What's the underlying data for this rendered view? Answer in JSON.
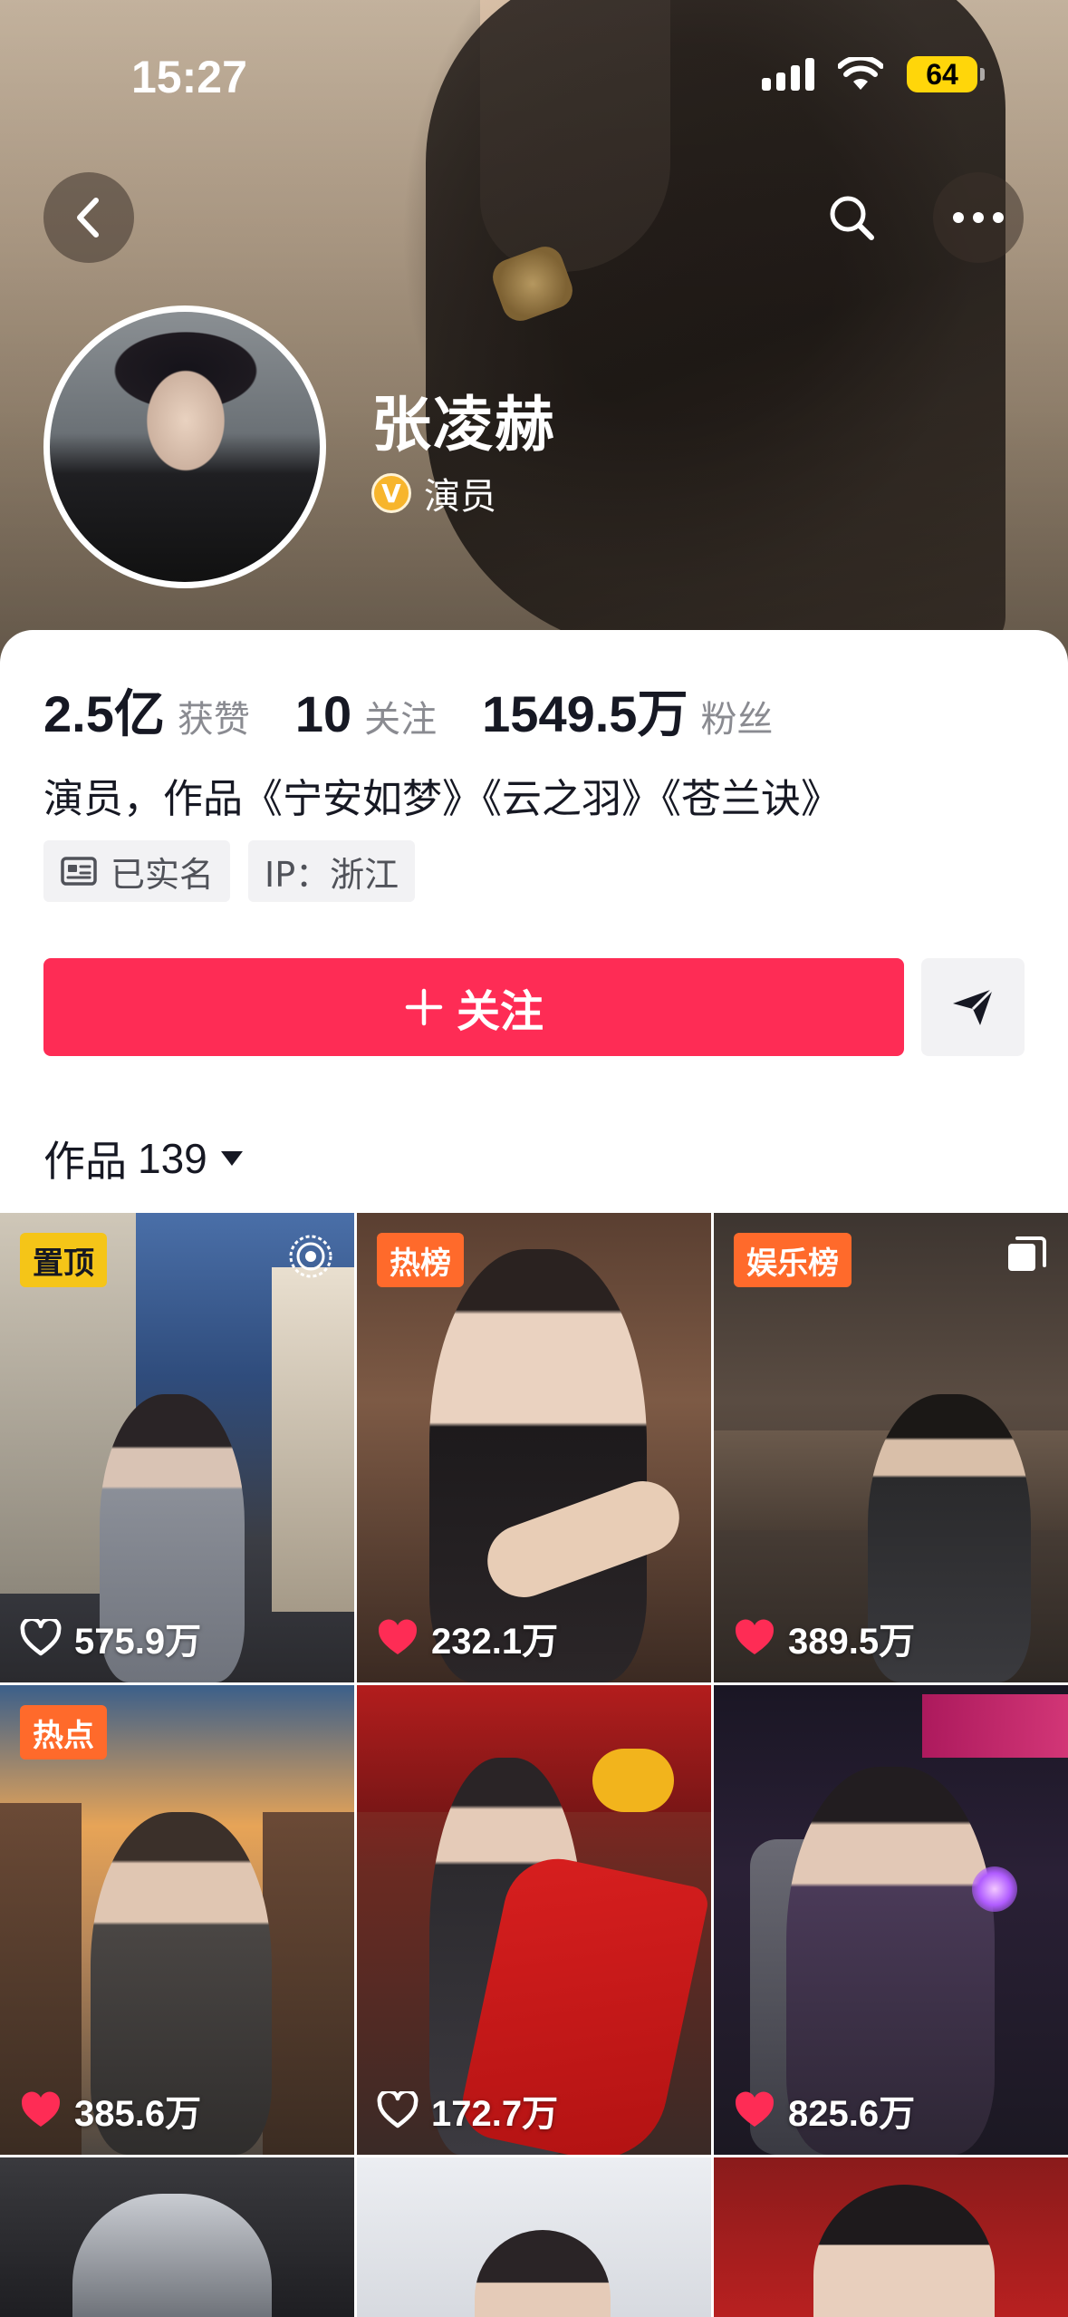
{
  "status_bar": {
    "time": "15:27",
    "battery": "64"
  },
  "profile": {
    "name": "张凌赫",
    "verified_title": "演员",
    "bio": "演员，作品《宁安如梦》《云之羽》《苍兰诀》"
  },
  "stats": [
    {
      "value": "2.5",
      "unit": "亿",
      "label": "获赞"
    },
    {
      "value": "10",
      "unit": "",
      "label": "关注"
    },
    {
      "value": "1549.5",
      "unit": "万",
      "label": "粉丝"
    }
  ],
  "tags": {
    "real_name": "已实名",
    "ip": "IP：浙江"
  },
  "actions": {
    "follow_label": "关注"
  },
  "works": {
    "label": "作品",
    "count": "139"
  },
  "videos": [
    {
      "badge": "置顶",
      "badge_color": "#f5c518",
      "likes": "575.9",
      "unit": "万",
      "liked": false,
      "corner": "live-icon"
    },
    {
      "badge": "热榜",
      "badge_color": "#ff6a2b",
      "likes": "232.1",
      "unit": "万",
      "liked": true,
      "corner": ""
    },
    {
      "badge": "娱乐榜",
      "badge_color": "#ff6a2b",
      "likes": "389.5",
      "unit": "万",
      "liked": true,
      "corner": "gallery-icon"
    },
    {
      "badge": "热点",
      "badge_color": "#ff6a2b",
      "likes": "385.6",
      "unit": "万",
      "liked": true,
      "corner": ""
    },
    {
      "badge": "",
      "badge_color": "",
      "likes": "172.7",
      "unit": "万",
      "liked": false,
      "corner": ""
    },
    {
      "badge": "",
      "badge_color": "",
      "likes": "825.6",
      "unit": "万",
      "liked": true,
      "corner": ""
    }
  ],
  "colors": {
    "accent": "#fe2c55",
    "verify": "#f7b52c"
  }
}
